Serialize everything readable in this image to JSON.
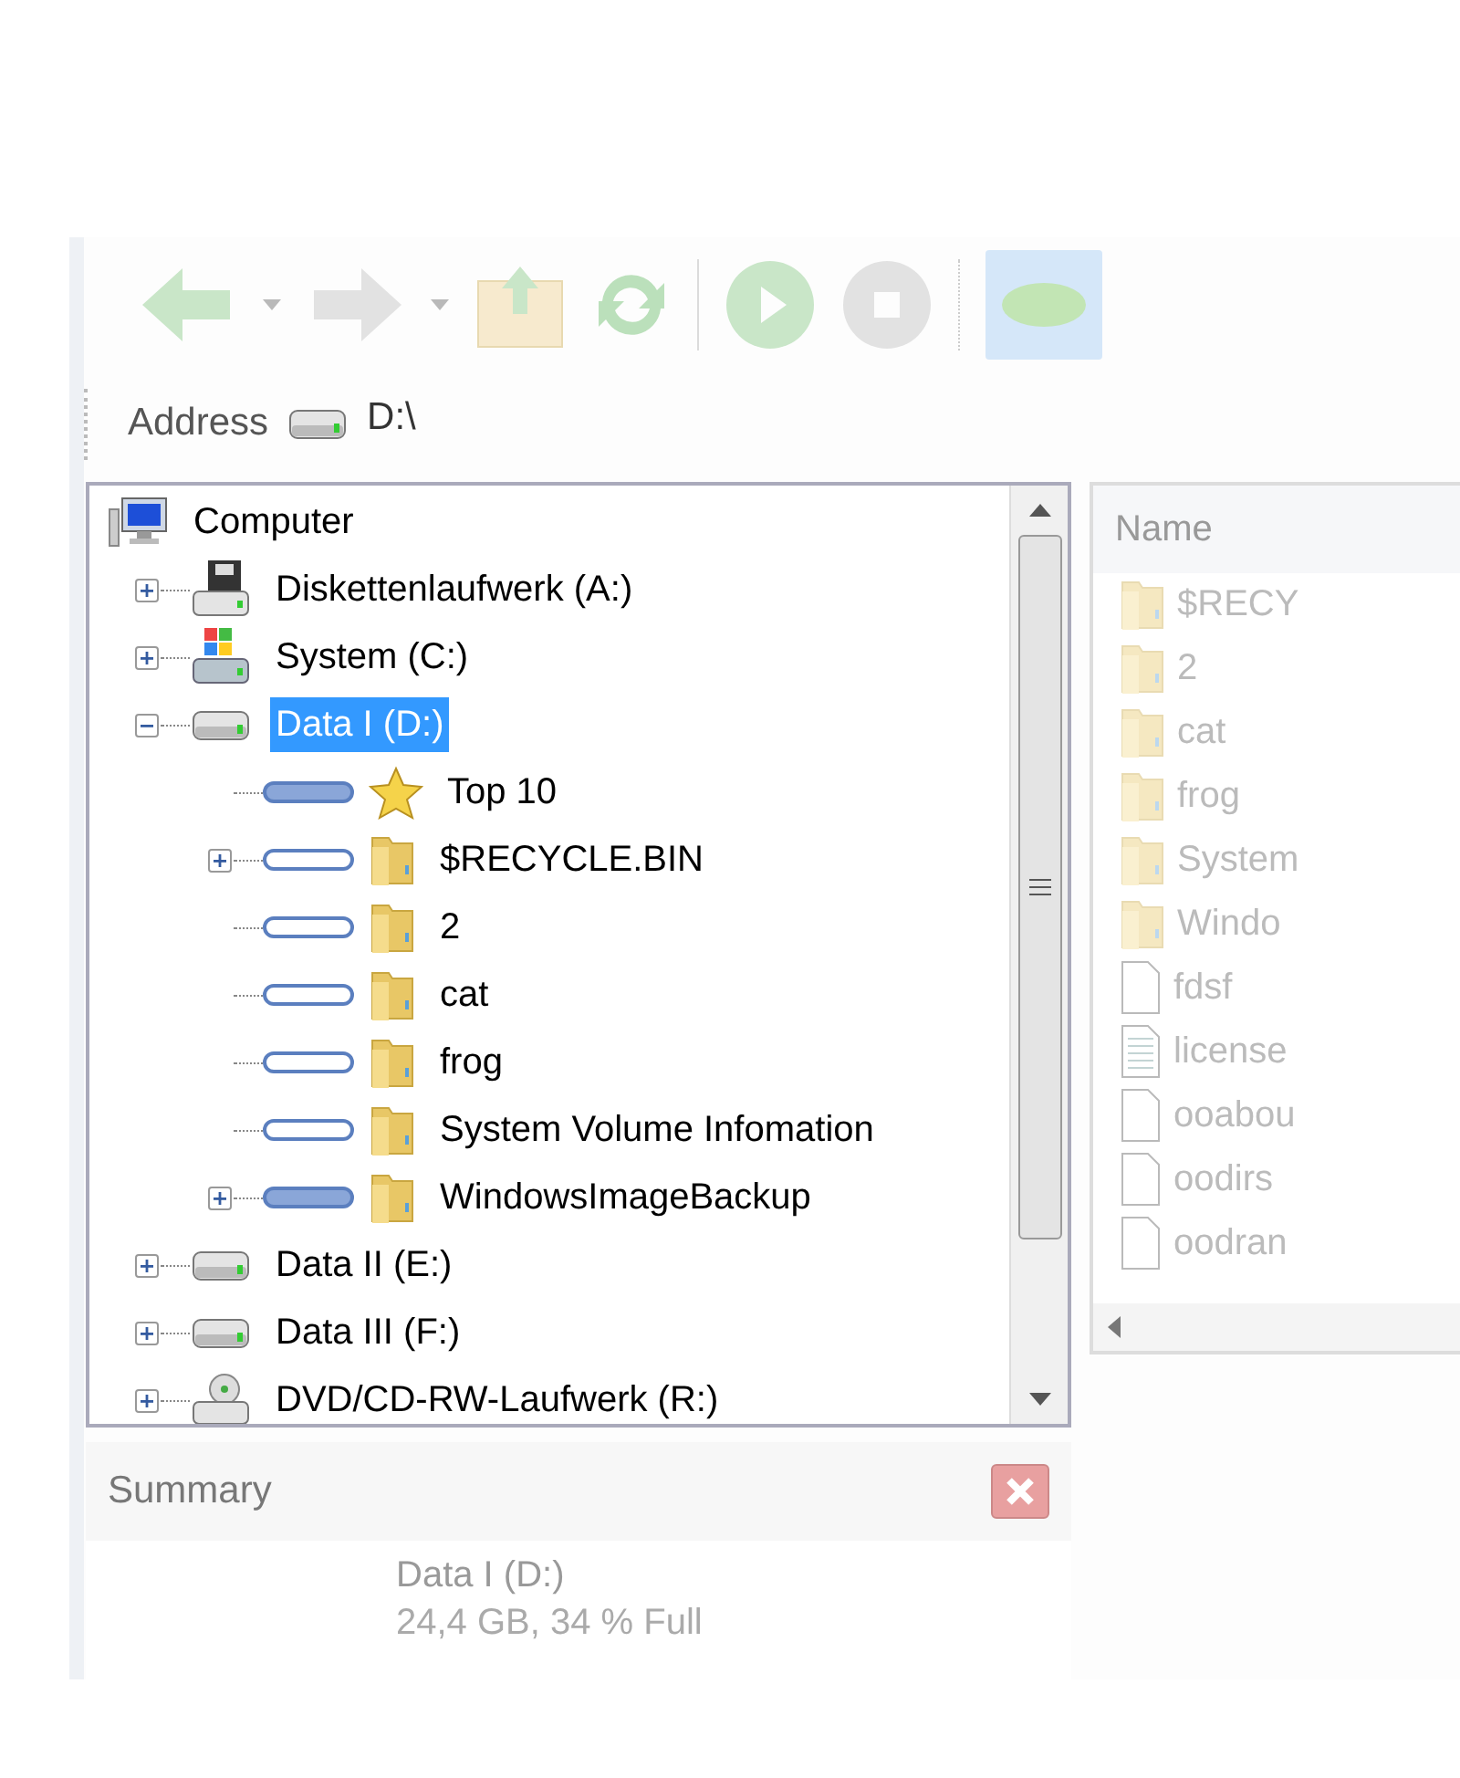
{
  "address_bar": {
    "label": "Address",
    "path": "D:\\"
  },
  "tree": [
    {
      "label": "Computer",
      "kind": "computer",
      "expandable": false,
      "selected": false,
      "children": [
        {
          "label": "Diskettenlaufwerk (A:)",
          "kind": "floppy",
          "expandable": true,
          "expanded": false,
          "selected": false
        },
        {
          "label": "System (C:)",
          "kind": "system-drive",
          "expandable": true,
          "expanded": false,
          "selected": false
        },
        {
          "label": "Data I (D:)",
          "kind": "drive",
          "expandable": true,
          "expanded": true,
          "selected": true,
          "children": [
            {
              "label": "Top 10",
              "kind": "favorites",
              "tagged": true,
              "expandable": false,
              "selected": false
            },
            {
              "label": "$RECYCLE.BIN",
              "kind": "folder",
              "tagged": false,
              "expandable": true,
              "expanded": false,
              "selected": false
            },
            {
              "label": "2",
              "kind": "folder",
              "tagged": false,
              "expandable": false,
              "selected": false
            },
            {
              "label": "cat",
              "kind": "folder",
              "tagged": false,
              "expandable": false,
              "selected": false
            },
            {
              "label": "frog",
              "kind": "folder",
              "tagged": false,
              "expandable": false,
              "selected": false
            },
            {
              "label": "System Volume Infomation",
              "kind": "folder",
              "tagged": false,
              "expandable": false,
              "selected": false
            },
            {
              "label": "WindowsImageBackup",
              "kind": "folder",
              "tagged": true,
              "expandable": true,
              "expanded": false,
              "selected": false
            }
          ]
        },
        {
          "label": "Data II (E:)",
          "kind": "drive",
          "expandable": true,
          "expanded": false,
          "selected": false
        },
        {
          "label": "Data III (F:)",
          "kind": "drive",
          "expandable": true,
          "expanded": false,
          "selected": false
        },
        {
          "label": "DVD/CD-RW-Laufwerk (R:)",
          "kind": "dvd",
          "expandable": true,
          "expanded": false,
          "selected": false
        }
      ]
    }
  ],
  "file_list": {
    "columns": [
      "Name"
    ],
    "rows": [
      {
        "name": "$RECY",
        "kind": "folder"
      },
      {
        "name": "2",
        "kind": "folder"
      },
      {
        "name": "cat",
        "kind": "folder"
      },
      {
        "name": "frog",
        "kind": "folder"
      },
      {
        "name": "System",
        "kind": "folder"
      },
      {
        "name": "Windo",
        "kind": "folder"
      },
      {
        "name": "fdsf",
        "kind": "file"
      },
      {
        "name": "license",
        "kind": "text"
      },
      {
        "name": "ooabou",
        "kind": "file"
      },
      {
        "name": "oodirs",
        "kind": "file"
      },
      {
        "name": "oodran",
        "kind": "file"
      }
    ]
  },
  "summary": {
    "title": "Summary",
    "lines": [
      "Data I (D:)",
      "24,4 GB, 34 % Full"
    ]
  }
}
